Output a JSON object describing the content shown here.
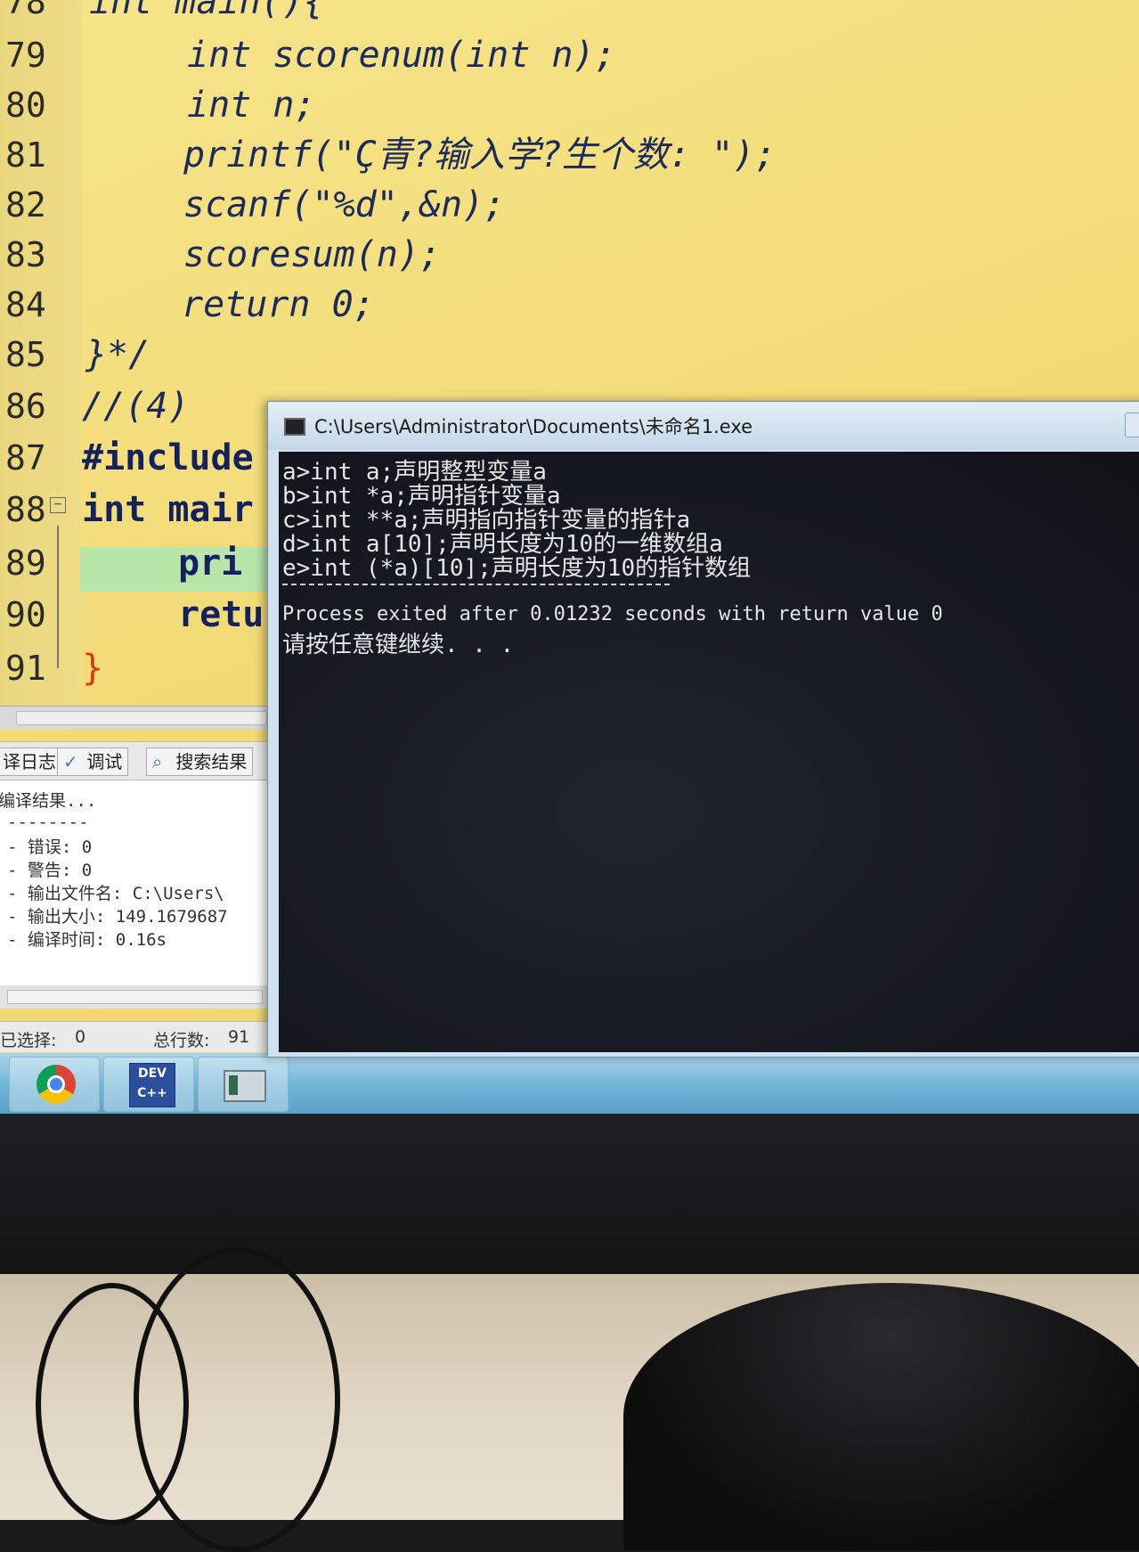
{
  "editor": {
    "lines": [
      {
        "num": "78",
        "code": "int main(){"
      },
      {
        "num": "79",
        "code": "int scorenum(int n);"
      },
      {
        "num": "80",
        "code": "int n;"
      },
      {
        "num": "81",
        "code": "printf(\"Ç青?输入学?生个数: \");"
      },
      {
        "num": "82",
        "code": "scanf(\"%d\",&n);"
      },
      {
        "num": "83",
        "code": "scoresum(n);"
      },
      {
        "num": "84",
        "code": "return 0;"
      },
      {
        "num": "85",
        "code": "}*/"
      },
      {
        "num": "86",
        "code": "//(4)"
      },
      {
        "num": "87",
        "code": "#include"
      },
      {
        "num": "88",
        "code": "int mair"
      },
      {
        "num": "89",
        "code": "pri"
      },
      {
        "num": "90",
        "code": "retu"
      },
      {
        "num": "91",
        "code": "}"
      }
    ]
  },
  "bottom_panel": {
    "tabs": [
      {
        "label": "译日志",
        "icon": "compile-log-icon"
      },
      {
        "label": "调试",
        "icon": "check-icon"
      },
      {
        "label": "搜索结果",
        "icon": "search-icon"
      }
    ],
    "log": [
      "编译结果...",
      "--------",
      "- 错误: 0",
      "- 警告: 0",
      "- 输出文件名: C:\\Users\\",
      "- 输出大小: 149.1679687",
      "- 编译时间: 0.16s"
    ]
  },
  "status_bar": {
    "selected_label": "已选择:",
    "selected_value": "0",
    "total_label": "总行数:",
    "total_value": "91"
  },
  "taskbar": {
    "apps": [
      "chrome-icon",
      "dev-cpp-icon",
      "console-icon"
    ],
    "devcpp_text_1": "DEV",
    "devcpp_text_2": "C++"
  },
  "console": {
    "title": "C:\\Users\\Administrator\\Documents\\未命名1.exe",
    "output": [
      "a>int a;声明整型变量a",
      "b>int *a;声明指针变量a",
      "c>int **a;声明指向指针变量的指针a",
      "d>int a[10];声明长度为10的一维数组a",
      "e>int (*a)[10];声明长度为10的指针数组"
    ],
    "separator": "--------------------------------",
    "exit_message": "Process exited after 0.01232 seconds with return value 0",
    "press_key": "请按任意键继续. . ."
  },
  "colors": {
    "editor_bg": "#f3dc78",
    "line_highlight": "#b8e6a9",
    "console_bg": "#14171e",
    "taskbar": "#6fb4d6"
  }
}
